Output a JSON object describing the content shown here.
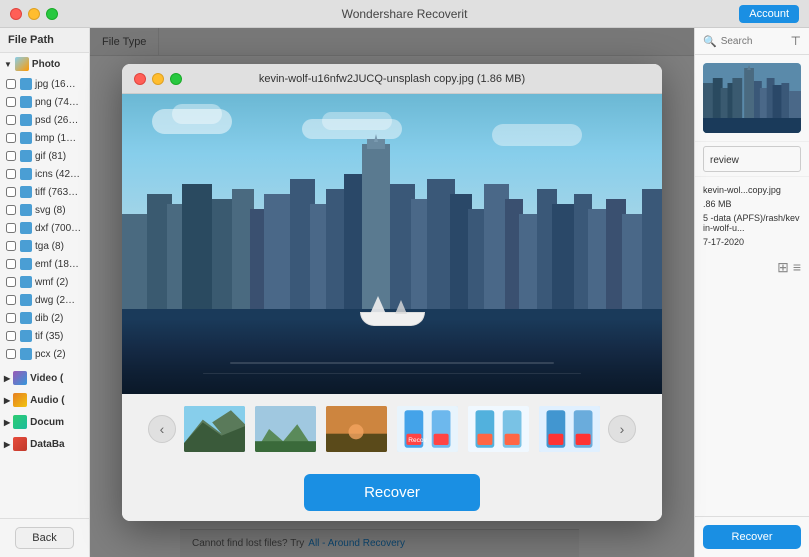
{
  "titleBar": {
    "title": "Wondershare Recoverit",
    "accountLabel": "Account",
    "buttons": {
      "close": "close",
      "minimize": "minimize",
      "maximize": "maximize"
    }
  },
  "sidebar": {
    "header": "File Path",
    "backButton": "Back",
    "groups": [
      {
        "label": "Photo",
        "expanded": true
      },
      {
        "label": "Video (",
        "expanded": false
      },
      {
        "label": "Audio (",
        "expanded": false
      },
      {
        "label": "Docum",
        "expanded": false
      },
      {
        "label": "DataBa",
        "expanded": false
      }
    ],
    "items": [
      {
        "label": "jpg (16…",
        "checked": false
      },
      {
        "label": "png (74…",
        "checked": false
      },
      {
        "label": "psd (26…",
        "checked": false
      },
      {
        "label": "bmp (1…",
        "checked": false
      },
      {
        "label": "gif (81)",
        "checked": false
      },
      {
        "label": "icns (42…",
        "checked": false
      },
      {
        "label": "tiff (763…",
        "checked": false
      },
      {
        "label": "svg (8)",
        "checked": false
      },
      {
        "label": "dxf (700…",
        "checked": false
      },
      {
        "label": "tga (8)",
        "checked": false
      },
      {
        "label": "emf (18…",
        "checked": false
      },
      {
        "label": "wmf (2)",
        "checked": false
      },
      {
        "label": "dwg (2…",
        "checked": false
      },
      {
        "label": "dib (2)",
        "checked": false
      },
      {
        "label": "tif (35)",
        "checked": false
      },
      {
        "label": "pcx (2)",
        "checked": false
      }
    ]
  },
  "columnHeaders": [
    {
      "label": "File Type"
    }
  ],
  "previewDialog": {
    "title": "kevin-wolf-u16nfw2JUCQ-unsplash copy.jpg (1.86 MB)",
    "buttons": {
      "close": "close",
      "minimize": "minimize",
      "maximize": "maximize"
    }
  },
  "thumbnails": [
    {
      "type": "mountains",
      "active": false
    },
    {
      "type": "valley",
      "active": false
    },
    {
      "type": "sunset",
      "active": false
    },
    {
      "type": "app1",
      "active": false
    },
    {
      "type": "app2",
      "active": false
    },
    {
      "type": "app3",
      "active": false
    }
  ],
  "recoverButton": "Recover",
  "navigation": {
    "prevLabel": "‹",
    "nextLabel": "›"
  },
  "rightPanel": {
    "searchPlaceholder": "Search",
    "previewLabel": "review",
    "fileInfo": {
      "name": "kevin-wol...copy.jpg",
      "size": ".86 MB",
      "path": "5 -data (APFS)/rash/kevin-wolf-u...",
      "date": "7-17-2020"
    },
    "recoverBtn": "Recover",
    "viewIcons": [
      "grid",
      "list"
    ]
  },
  "bottomBar": {
    "text": "Cannot find lost files? Try",
    "linkText": "All - Around Recovery"
  }
}
